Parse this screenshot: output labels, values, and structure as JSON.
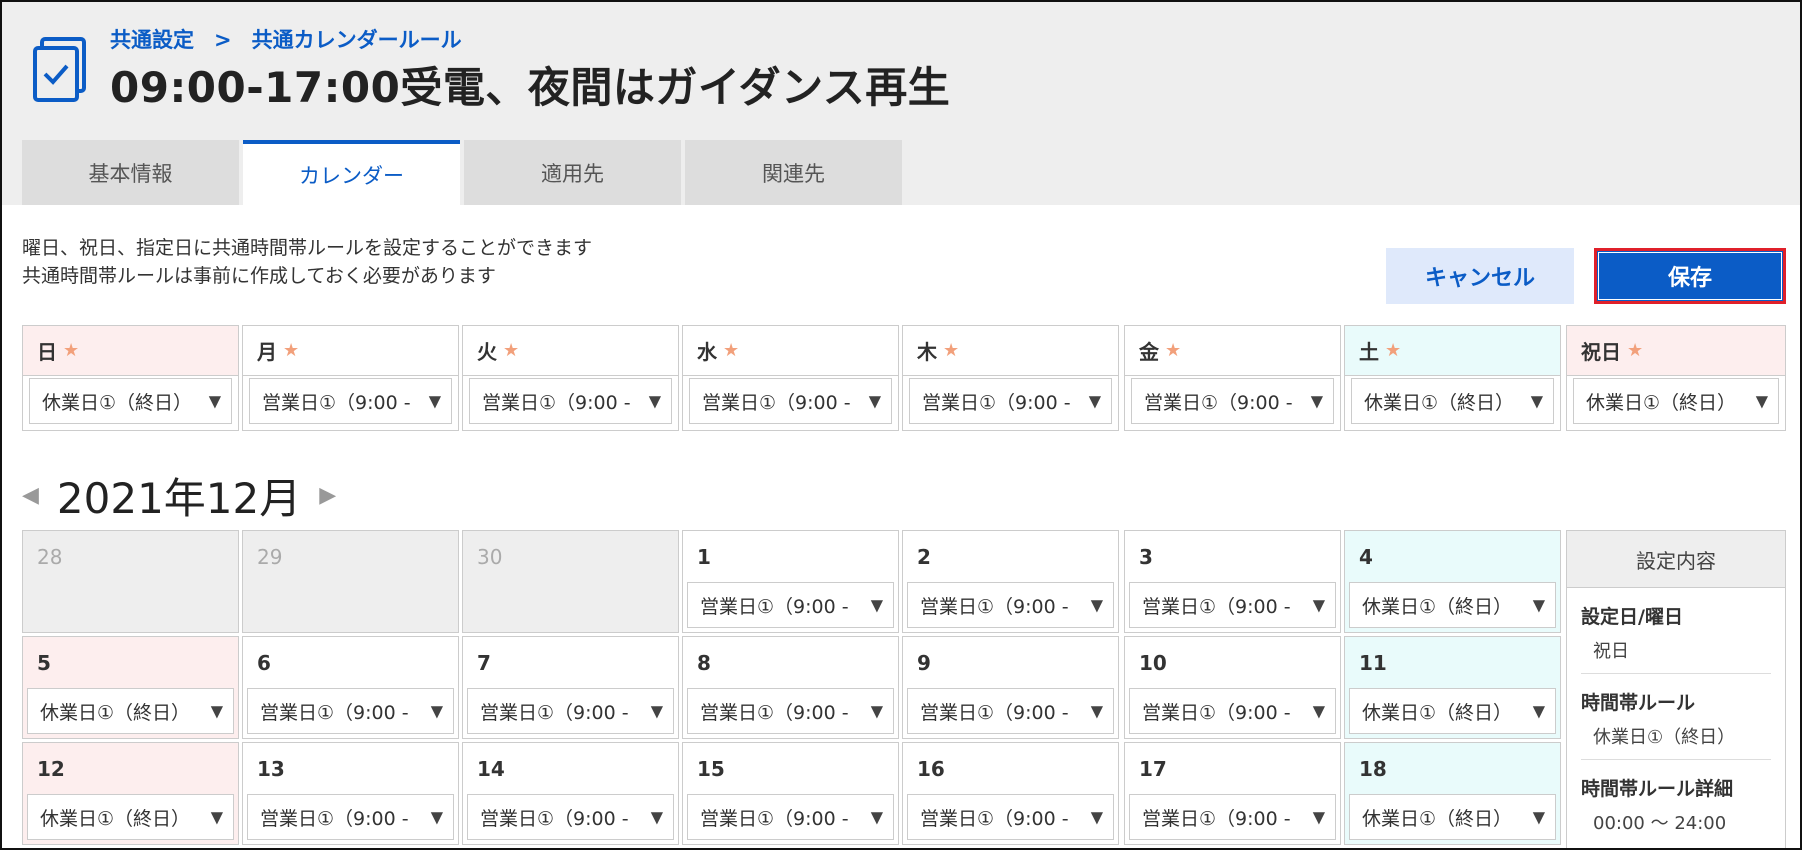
{
  "breadcrumb": {
    "parent": "共通設定",
    "separator": ">",
    "current": "共通カレンダールール"
  },
  "page_title": "09:00-17:00受電、夜間はガイダンス再生",
  "tabs": [
    {
      "label": "基本情報",
      "active": false
    },
    {
      "label": "カレンダー",
      "active": true
    },
    {
      "label": "適用先",
      "active": false
    },
    {
      "label": "関連先",
      "active": false
    }
  ],
  "description": {
    "line1": "曜日、祝日、指定日に共通時間帯ルールを設定することができます",
    "line2": "共通時間帯ルールは事前に作成しておく必要があります"
  },
  "buttons": {
    "cancel": "キャンセル",
    "save": "保存"
  },
  "weekday_rules": [
    {
      "day": "日",
      "value": "休業日①（終日）"
    },
    {
      "day": "月",
      "value": "営業日①（9:00 -"
    },
    {
      "day": "火",
      "value": "営業日①（9:00 -"
    },
    {
      "day": "水",
      "value": "営業日①（9:00 -"
    },
    {
      "day": "木",
      "value": "営業日①（9:00 -"
    },
    {
      "day": "金",
      "value": "営業日①（9:00 -"
    },
    {
      "day": "土",
      "value": "休業日①（終日）"
    },
    {
      "day": "祝日",
      "value": "休業日①（終日）"
    }
  ],
  "star_glyph": "★",
  "dropdown_arrow": "▼",
  "month_nav": {
    "prev": "◀",
    "label": "2021年12月",
    "next": "▶"
  },
  "calendar": {
    "row1": [
      {
        "day": "28",
        "value": ""
      },
      {
        "day": "29",
        "value": ""
      },
      {
        "day": "30",
        "value": ""
      },
      {
        "day": "1",
        "value": "営業日①（9:00 -"
      },
      {
        "day": "2",
        "value": "営業日①（9:00 -"
      },
      {
        "day": "3",
        "value": "営業日①（9:00 -"
      },
      {
        "day": "4",
        "value": "休業日①（終日）"
      }
    ],
    "row2": [
      {
        "day": "5",
        "value": "休業日①（終日）"
      },
      {
        "day": "6",
        "value": "営業日①（9:00 -"
      },
      {
        "day": "7",
        "value": "営業日①（9:00 -"
      },
      {
        "day": "8",
        "value": "営業日①（9:00 -"
      },
      {
        "day": "9",
        "value": "営業日①（9:00 -"
      },
      {
        "day": "10",
        "value": "営業日①（9:00 -"
      },
      {
        "day": "11",
        "value": "休業日①（終日）"
      }
    ],
    "row3": [
      {
        "day": "12",
        "value": "休業日①（終日）"
      },
      {
        "day": "13",
        "value": "営業日①（9:00 -"
      },
      {
        "day": "14",
        "value": "営業日①（9:00 -"
      },
      {
        "day": "15",
        "value": "営業日①（9:00 -"
      },
      {
        "day": "16",
        "value": "営業日①（9:00 -"
      },
      {
        "day": "17",
        "value": "営業日①（9:00 -"
      },
      {
        "day": "18",
        "value": "休業日①（終日）"
      }
    ]
  },
  "side_panel": {
    "title": "設定内容",
    "date_label": "設定日/曜日",
    "date_value": "祝日",
    "rule_label": "時間帯ルール",
    "rule_value": "休業日①（終日）",
    "detail_label": "時間帯ルール詳細",
    "detail_value": "00:00 ～ 24:00"
  },
  "colors": {
    "accent": "#0b5cc6",
    "save_border": "#e0202a",
    "sunday_bg": "#fdeeee",
    "saturday_bg": "#e9fbfb",
    "star": "#f2a07b"
  }
}
